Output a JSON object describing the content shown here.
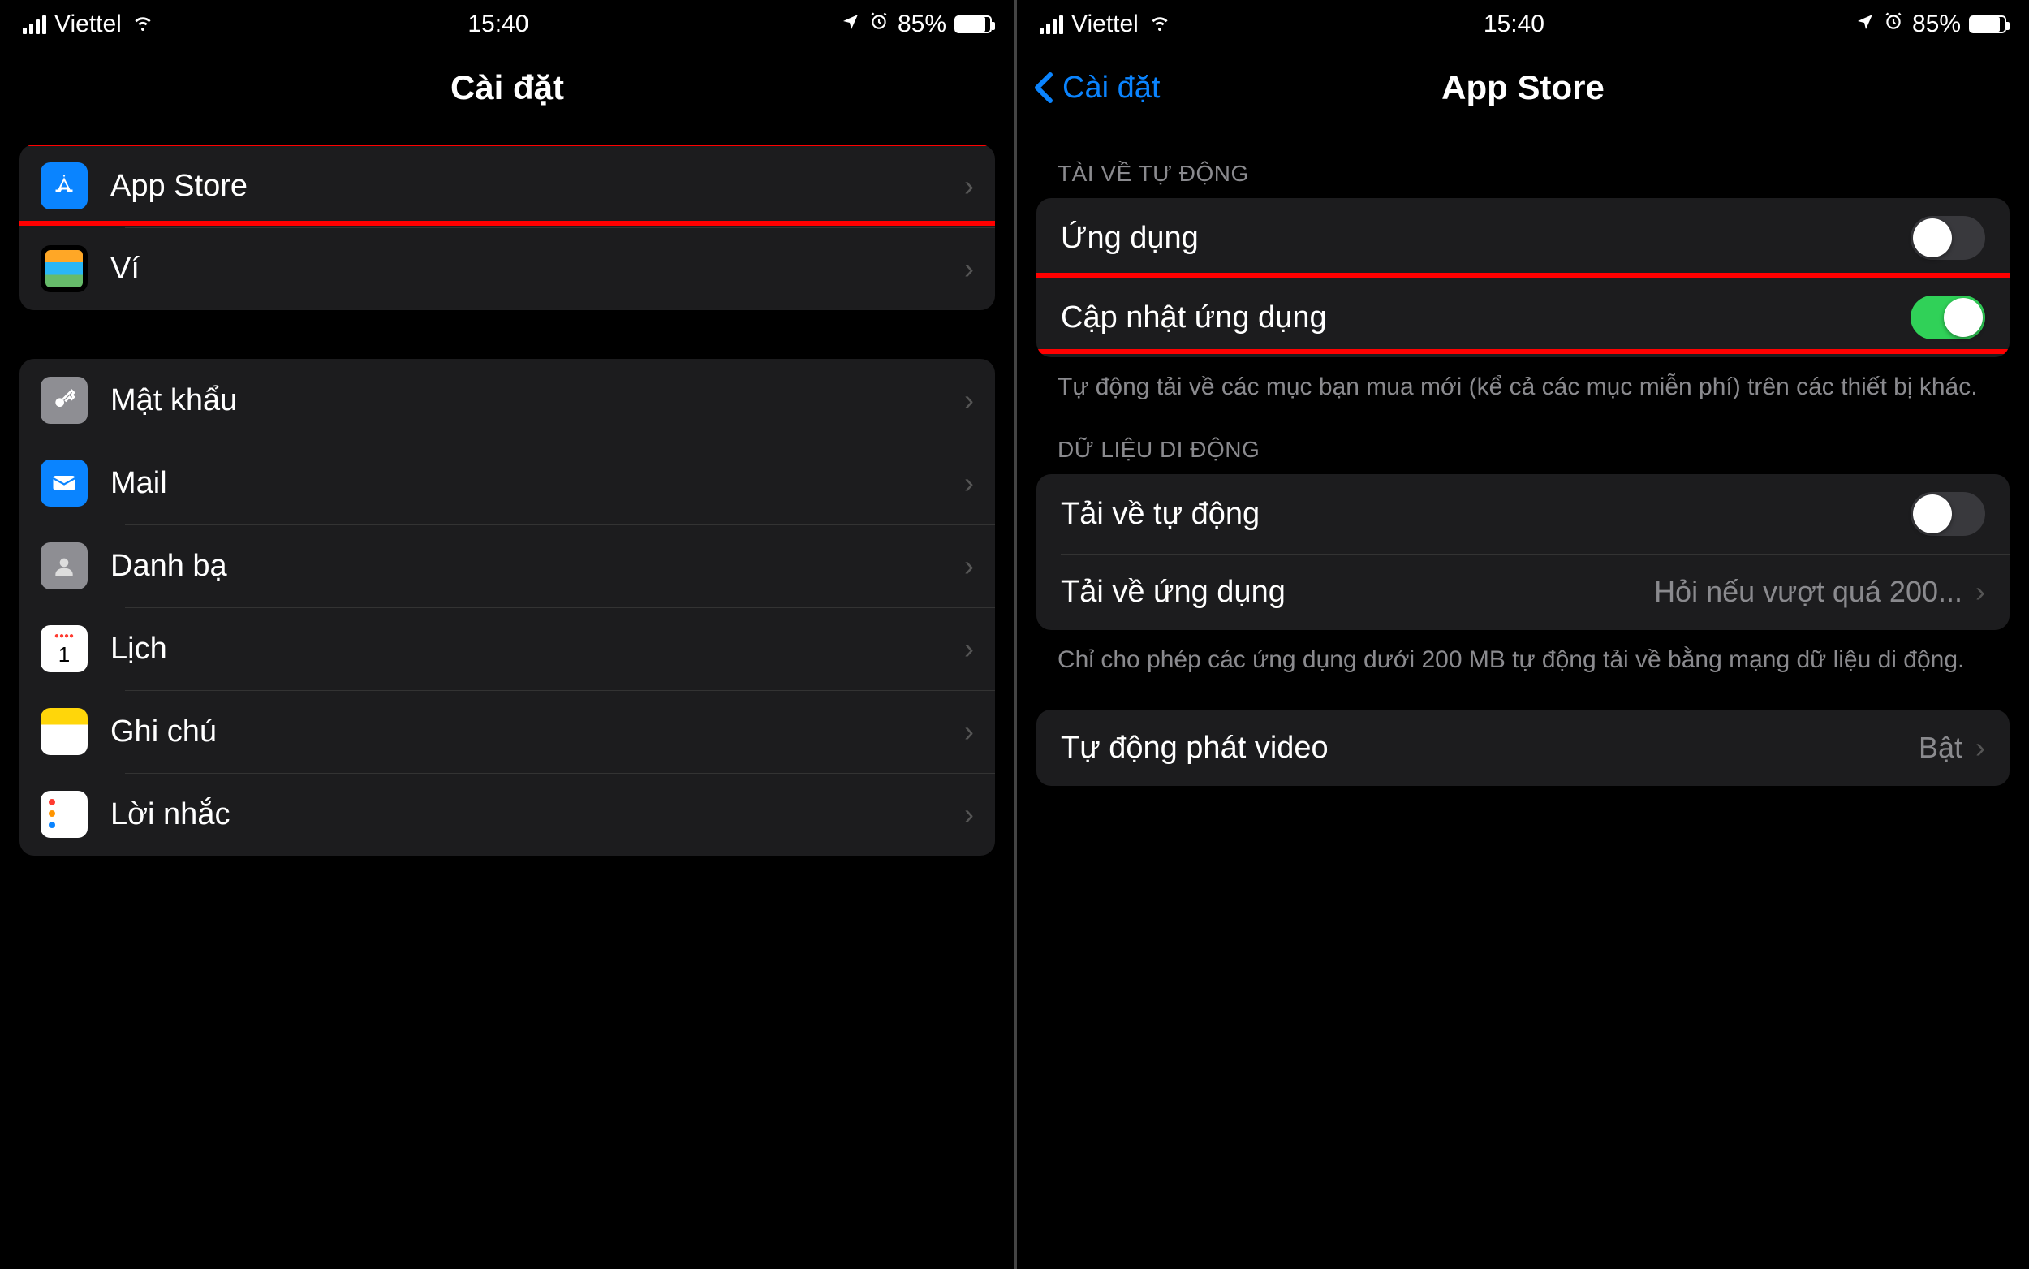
{
  "statusBar": {
    "carrier": "Viettel",
    "time": "15:40",
    "battery": "85%"
  },
  "screenLeft": {
    "title": "Cài đặt",
    "group1": [
      {
        "label": "App Store"
      },
      {
        "label": "Ví"
      }
    ],
    "group2": [
      {
        "label": "Mật khẩu"
      },
      {
        "label": "Mail"
      },
      {
        "label": "Danh bạ"
      },
      {
        "label": "Lịch"
      },
      {
        "label": "Ghi chú"
      },
      {
        "label": "Lời nhắc"
      }
    ]
  },
  "screenRight": {
    "backLabel": "Cài đặt",
    "title": "App Store",
    "section1": {
      "header": "TÀI VỀ TỰ ĐỘNG",
      "rows": [
        {
          "label": "Ứng dụng"
        },
        {
          "label": "Cập nhật ứng dụng"
        }
      ],
      "footer": "Tự động tải về các mục bạn mua mới (kể cả các mục miễn phí) trên các thiết bị khác."
    },
    "section2": {
      "header": "DỮ LIỆU DI ĐỘNG",
      "rows": [
        {
          "label": "Tải về tự động"
        },
        {
          "label": "Tải về ứng dụng",
          "value": "Hỏi nếu vượt quá 200..."
        }
      ],
      "footer": "Chỉ cho phép các ứng dụng dưới 200 MB tự động tải về bằng mạng dữ liệu di động."
    },
    "section3": {
      "rows": [
        {
          "label": "Tự động phát video",
          "value": "Bật"
        }
      ]
    }
  }
}
